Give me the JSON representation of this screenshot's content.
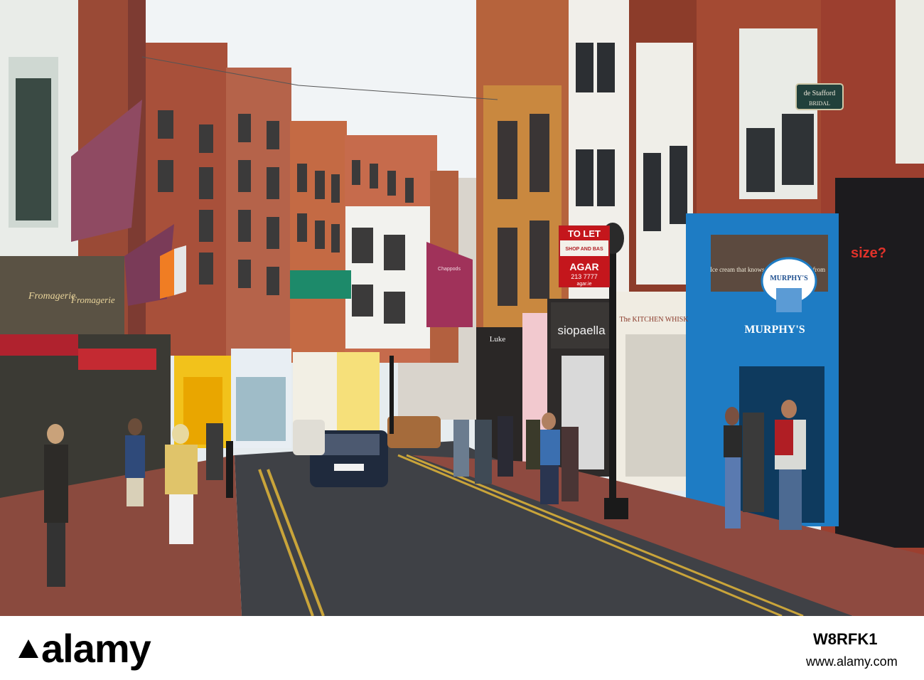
{
  "signs": {
    "to_let": "TO LET",
    "shop_and_base": "SHOP AND BAS",
    "agar": "AGAR",
    "agar_phone": "213 7777",
    "agar_web": "agar.ie",
    "siopaella": "siopaella",
    "kitchen_whisk": "The KITCHEN WHISK",
    "murphys": "MURPHY'S",
    "murphys_hanging": "MURPHY'S",
    "murphys_tagline": "Ice cream that knows where it's coming from",
    "size": "size?",
    "de_stafford": "de Stafford",
    "bridal": "BRIDAL",
    "fromagerie": "Fromagerie",
    "dogpods": "Chappods",
    "luke": "Luke"
  },
  "watermark": {
    "brand": "alamy",
    "image_id": "W8RFK1",
    "url": "www.alamy.com"
  },
  "colors": {
    "sky": "#e8eef2",
    "road": "#3f4146",
    "pavement": "#8a4a3e",
    "blue_shop": "#1e7cc4",
    "yellow_shop": "#f2c21b",
    "brick": "#a5503a"
  }
}
